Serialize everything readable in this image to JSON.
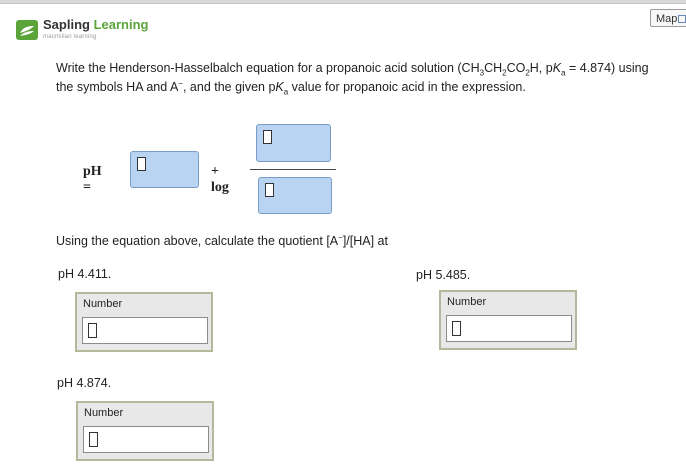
{
  "header": {
    "brand_primary": "Sapling",
    "brand_secondary": "Learning",
    "brand_sub": "macmillan learning",
    "map_label": "Map",
    "brand_color": "#5aa43a"
  },
  "question": {
    "line1_a": "Write the Henderson-Hasselbalch equation for a propanoic acid solution (CH",
    "sub1": "3",
    "line1_b": "CH",
    "sub2": "2",
    "line1_c": "CO",
    "sub3": "2",
    "line1_d": "H, p",
    "ka_k": "K",
    "ka_sub": "a",
    "line1_e": " = 4.874) using",
    "line2_a": "the symbols HA and A",
    "sup_minus": "−",
    "line2_b": ", and the given p",
    "line2_k": "K",
    "line2_sub": "a",
    "line2_c": " value for propanoic acid in the expression."
  },
  "equation": {
    "ph_label": "pH =",
    "plus_log": "+ log"
  },
  "calc_prompt": {
    "text_a": "Using the equation above, calculate the quotient [A",
    "sup_minus": "−",
    "text_b": "]/[HA] at"
  },
  "answers": [
    {
      "ph_label": "pH 4.411.",
      "field_label": "Number"
    },
    {
      "ph_label": "pH 5.485.",
      "field_label": "Number"
    },
    {
      "ph_label": "pH 4.874.",
      "field_label": "Number"
    }
  ]
}
